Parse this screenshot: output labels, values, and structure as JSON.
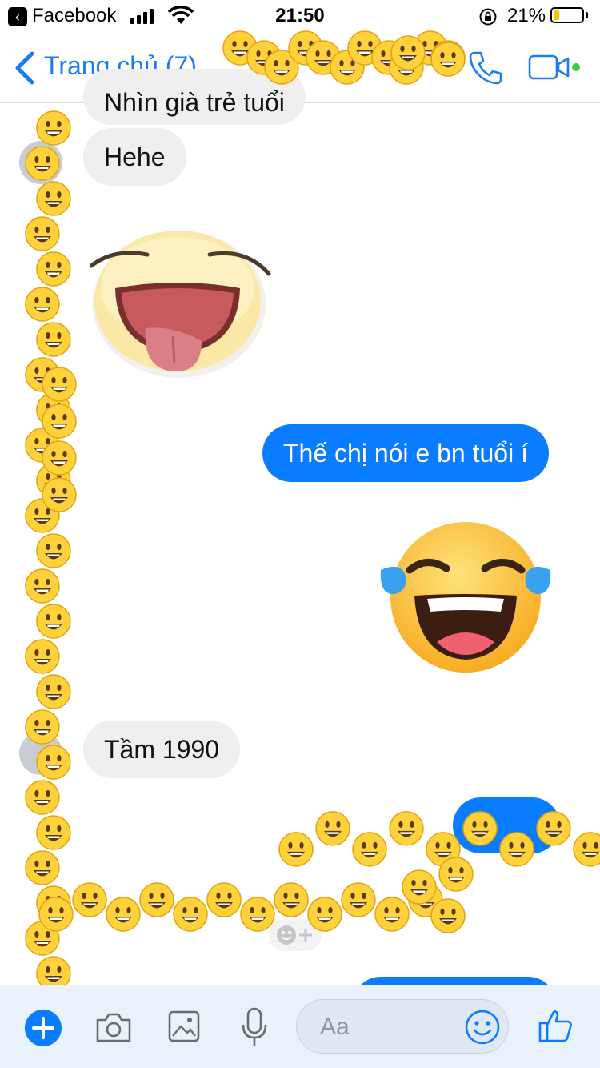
{
  "status_bar": {
    "back_app_label": "Facebook",
    "time": "21:50",
    "battery_percent": "21%",
    "battery_level": 0.21,
    "signal_bars": 4
  },
  "header": {
    "back_label": "Trang chủ (7)"
  },
  "messages": [
    {
      "direction": "incoming",
      "text": "Nhìn già trẻ tuổi"
    },
    {
      "direction": "incoming",
      "text": "Hehe"
    },
    {
      "direction": "incoming",
      "type": "sticker",
      "icon": "tongue-out-sticker-icon"
    },
    {
      "direction": "outgoing",
      "text": "Thế chị nói e bn tuổi í"
    },
    {
      "direction": "outgoing",
      "type": "sticker",
      "icon": "tears-of-joy-sticker-icon"
    },
    {
      "direction": "incoming",
      "text": "Tầm 1990"
    }
  ],
  "composer": {
    "placeholder": "Aa"
  },
  "colors": {
    "accent": "#0a7cff",
    "incoming_bubble": "#efefef",
    "composer_bg": "#e9f1fb",
    "emoji_yellow": "#ffd13a"
  }
}
